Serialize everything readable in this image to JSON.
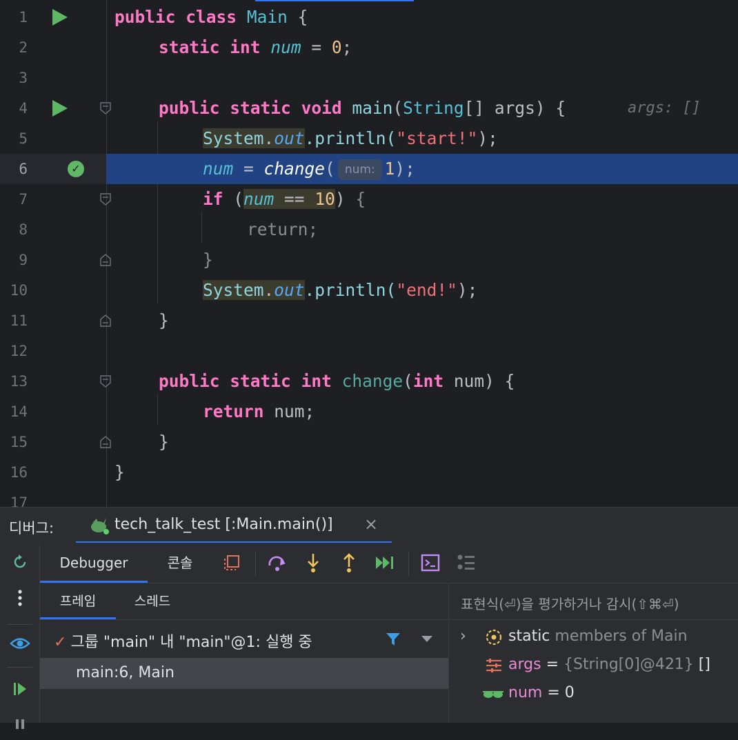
{
  "editor": {
    "lines": [
      {
        "n": "1"
      },
      {
        "n": "2"
      },
      {
        "n": "3"
      },
      {
        "n": "4"
      },
      {
        "n": "5"
      },
      {
        "n": "6"
      },
      {
        "n": "7"
      },
      {
        "n": "8"
      },
      {
        "n": "9"
      },
      {
        "n": "10"
      },
      {
        "n": "11"
      },
      {
        "n": "12"
      },
      {
        "n": "13"
      },
      {
        "n": "14"
      },
      {
        "n": "15"
      },
      {
        "n": "16"
      },
      {
        "n": "17"
      }
    ],
    "current_line": "6",
    "tokens": {
      "l1": {
        "public": "public",
        "class": "class",
        "name": "Main",
        "brace": " {"
      },
      "l2": {
        "static": "static",
        "int": "int",
        "var": "num",
        "rest1": " = ",
        "zero": "0",
        "semi": ";"
      },
      "l4": {
        "public": "public",
        "static": "static",
        "void": "void",
        "method": "main",
        "open": "(",
        "type": "String",
        "rest": "[] args) {",
        "inlay": "args: []"
      },
      "l5": {
        "sys": "System",
        "dot": ".",
        "out": "out",
        "call": ".println(",
        "str": "\"start!\"",
        "end": ");"
      },
      "l6": {
        "var": "num",
        "eq": " = ",
        "method": "change",
        "open": "(",
        "hint": "num:",
        "arg": "1",
        "end": ");"
      },
      "l7": {
        "if": "if",
        "open": " (",
        "var": "num",
        "op": " == ",
        "ten": "10",
        "close": ")",
        "brace": " {"
      },
      "l8": {
        "ret": "return",
        "semi": ";"
      },
      "l9": {
        "brace": "}"
      },
      "l10": {
        "sys": "System",
        "dot": ".",
        "out": "out",
        "call": ".println(",
        "str": "\"end!\"",
        "end": ");"
      },
      "l11": {
        "brace": "}"
      },
      "l13": {
        "public": "public",
        "static": "static",
        "int": "int",
        "method": "change",
        "open": "(",
        "int2": "int",
        "rest": " num) {"
      },
      "l14": {
        "ret": "return",
        "rest": " num;"
      },
      "l15": {
        "brace": "}"
      },
      "l16": {
        "brace": "}"
      }
    }
  },
  "debug_panel": {
    "label": "디버그:",
    "session": "tech_talk_test [:Main.main()]",
    "close": "×"
  },
  "toolbar": {
    "tab_debugger": "Debugger",
    "tab_console": "콘솔"
  },
  "frames": {
    "tab_frames": "프레임",
    "tab_threads": "스레드",
    "thread_check": "✓",
    "thread": "그룹 \"main\" 내 \"main\"@1: 실행 중",
    "frame": "main:6, Main"
  },
  "variables": {
    "eval_placeholder": "표현식(⏎)을 평가하거나 감시(⇧⌘⏎)",
    "items": [
      {
        "name": "static",
        "desc": " members of Main"
      },
      {
        "name": "args",
        "eq": " = ",
        "value": "{String[0]@421}",
        "extra": " []"
      },
      {
        "name": "num",
        "eq": " = ",
        "value": "0"
      }
    ]
  },
  "colors": {
    "accent": "#3574f0",
    "run_green": "#5fb865",
    "current_line": "#214283",
    "keyword": "#ff79c6"
  }
}
